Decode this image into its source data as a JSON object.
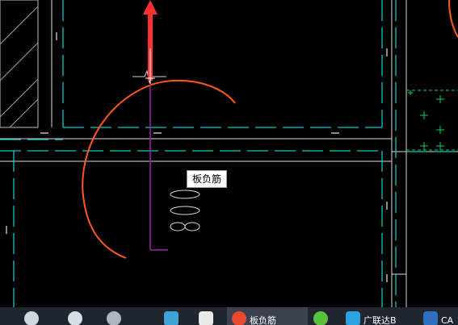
{
  "tooltip": {
    "text": "板负筋"
  },
  "taskbar": {
    "items": [
      {
        "name": "taskbar-app-1",
        "icon": "cloud-icon",
        "color": "#cfd6de",
        "label": ""
      },
      {
        "name": "taskbar-app-2",
        "icon": "browser-icon",
        "color": "#d7dde4",
        "label": ""
      },
      {
        "name": "taskbar-app-3",
        "icon": "swirl-icon",
        "color": "#aeb6bf",
        "label": ""
      },
      {
        "name": "taskbar-app-4",
        "icon": "calculator-icon",
        "color": "#3da4d8",
        "label": ""
      },
      {
        "name": "taskbar-app-5",
        "icon": "camera-icon",
        "color": "#e9e9e9",
        "label": ""
      },
      {
        "name": "taskbar-app-6",
        "icon": "colorful-app-icon",
        "color": "#e8492f",
        "label": "板负筋",
        "active": true
      },
      {
        "name": "taskbar-app-7",
        "icon": "green-globe-icon",
        "color": "#5cc13a",
        "label": ""
      },
      {
        "name": "taskbar-app-8",
        "icon": "t-app-icon",
        "color": "#2aa3e0",
        "label": "广联达B"
      },
      {
        "name": "taskbar-app-9",
        "icon": "cad-icon",
        "color": "#2f6fbf",
        "label": "CA"
      }
    ]
  },
  "colors": {
    "axis": "#10c8c8",
    "wall": "#d8d8d8",
    "purple": "#a020a0",
    "arc": "#ff5a1a",
    "cursor": "#ff3030",
    "green": "#10d060"
  }
}
